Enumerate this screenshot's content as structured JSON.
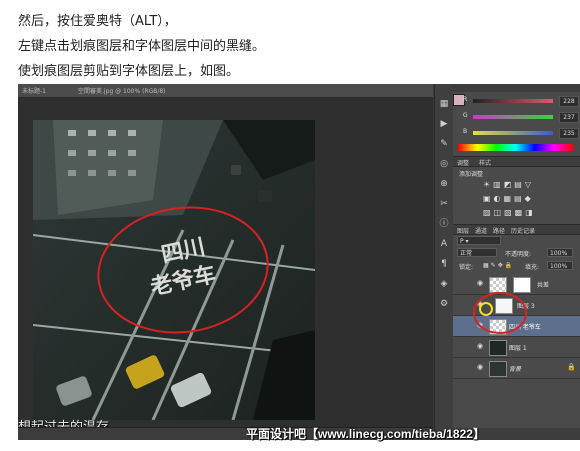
{
  "instructions": {
    "line1": "然后，按住爱奥特（ALT），",
    "line2": "左键点击划痕图层和字体图层中间的黑缝。",
    "line3": "使划痕图层剪贴到字体图层上，如图。"
  },
  "photoshop": {
    "doc_tab": "未标题-1",
    "file_tab": "空間審美.jpg @ 100% (RGB/8)",
    "canvas_text": {
      "line1": "四川",
      "line2": "老爷车"
    },
    "caption": "想起过去的温存",
    "color_panel": {
      "rows": [
        {
          "label": "R",
          "value": "228",
          "color": "#e05a6a"
        },
        {
          "label": "G",
          "value": "237",
          "color": "#3bd23b"
        },
        {
          "label": "B",
          "value": "235",
          "color": "#3b5bd2"
        }
      ]
    },
    "adjust_tabs": {
      "tab1": "调整",
      "tab2": "样式"
    },
    "adjust_title": "添加调整",
    "adjust_icons": {
      "row1": "☀▥◩▤▽",
      "row2": "▣◐▦▤◆",
      "row3": "▨◫▧▩◨"
    },
    "layers_tabs": {
      "tab1": "图层",
      "tab2": "通道",
      "tab3": "路径",
      "tab4": "历史记录"
    },
    "blend_mode": "正常",
    "opacity_label": "不透明度:",
    "opacity_value": "100%",
    "lock_label": "锁定:",
    "fill_label": "填充:",
    "fill_value": "100%",
    "layers": [
      {
        "name": "共差",
        "selected": false
      },
      {
        "name": "图层 3",
        "selected": false
      },
      {
        "name": "四川 老爷车",
        "selected": true
      },
      {
        "name": "图层 1",
        "selected": false
      },
      {
        "name": "背景",
        "selected": false
      }
    ]
  },
  "watermark": "平面设计吧【www.linecg.com/tieba/1822】"
}
